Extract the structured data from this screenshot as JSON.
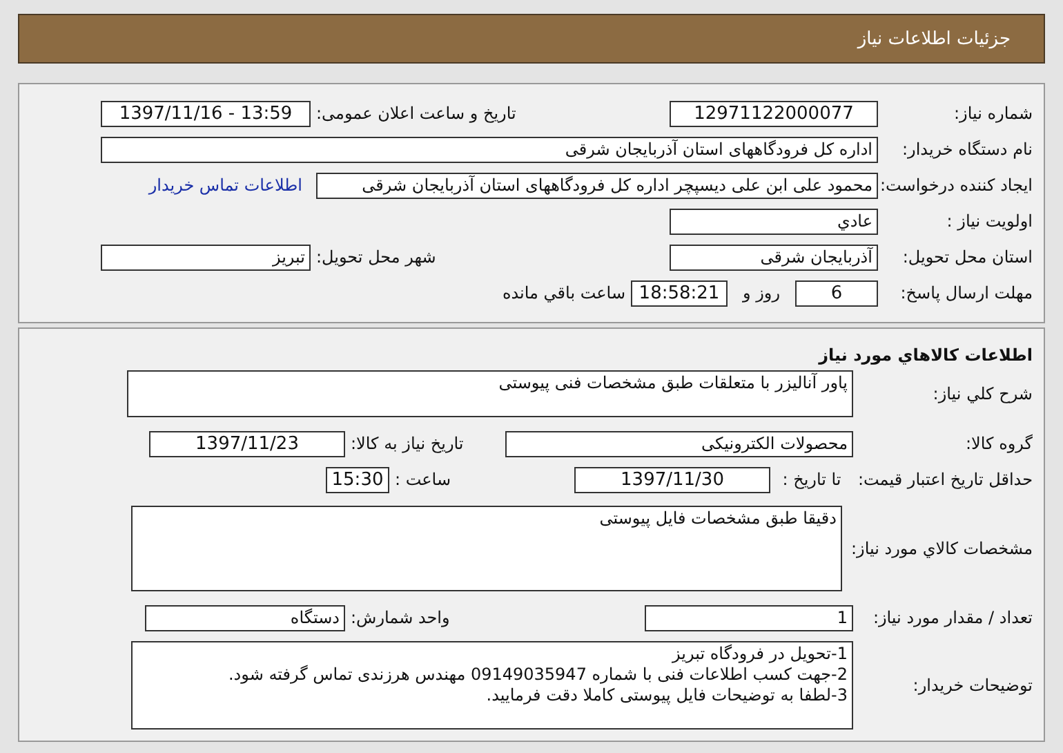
{
  "header": {
    "title": "جزئیات اطلاعات نیاز"
  },
  "summary": {
    "need_number": {
      "label": "شماره نیاز:",
      "value": "12971122000077"
    },
    "announce_datetime": {
      "label": "تاریخ و ساعت اعلان عمومی:",
      "value": "1397/11/16 - 13:59"
    },
    "buyer_org": {
      "label": "نام دستگاه خریدار:",
      "value": "اداره کل فرودگاههای استان آذربایجان شرقی"
    },
    "requester": {
      "label": "ایجاد کننده درخواست:",
      "value": "محمود علی ابن علی دیسپچر اداره کل فرودگاههای استان آذربایجان شرقی",
      "link": "اطلاعات تماس خریدار"
    },
    "priority": {
      "label": "اولویت نیاز :",
      "value": "عادي"
    },
    "province": {
      "label": "استان محل تحویل:",
      "value": "آذربایجان شرقی"
    },
    "city": {
      "label": "شهر محل تحویل:",
      "value": "تبریز"
    },
    "deadline": {
      "label": "مهلت ارسال پاسخ:",
      "days": "6",
      "days_suffix": "روز و",
      "time": "18:58:21",
      "time_suffix": "ساعت باقي مانده"
    }
  },
  "goods": {
    "title": "اطلاعات کالاهاي مورد نیاز",
    "description": {
      "label": "شرح کلي نیاز:",
      "value": "پاور آنالیزر با متعلقات طبق مشخصات فنی پیوستی"
    },
    "group": {
      "label": "گروه کالا:",
      "value": "محصولات الکترونیکی"
    },
    "need_date": {
      "label": "تاریخ نیاز به کالا:",
      "value": "1397/11/23"
    },
    "price_validity": {
      "label": "حداقل تاریخ اعتبار قیمت:",
      "date_label": "تا تاریخ :",
      "date": "1397/11/30",
      "time_label": "ساعت :",
      "time": "15:30"
    },
    "specs": {
      "label": "مشخصات کالاي مورد نیاز:",
      "value": "دقیقا طبق مشخصات فایل پیوستی"
    },
    "quantity": {
      "label": "تعداد / مقدار مورد نیاز:",
      "value": "1"
    },
    "unit": {
      "label": "واحد شمارش:",
      "value": "دستگاه"
    },
    "notes": {
      "label": "توضیحات خریدار:",
      "lines": [
        "1-تحویل در فرودگاه تبریز",
        "2-جهت کسب اطلاعات فنی با شماره 09149035947 مهندس هرزندی تماس گرفته شود.",
        "3-لطفا به توضیحات فایل پیوستی کاملا دقت فرمایید."
      ]
    }
  }
}
